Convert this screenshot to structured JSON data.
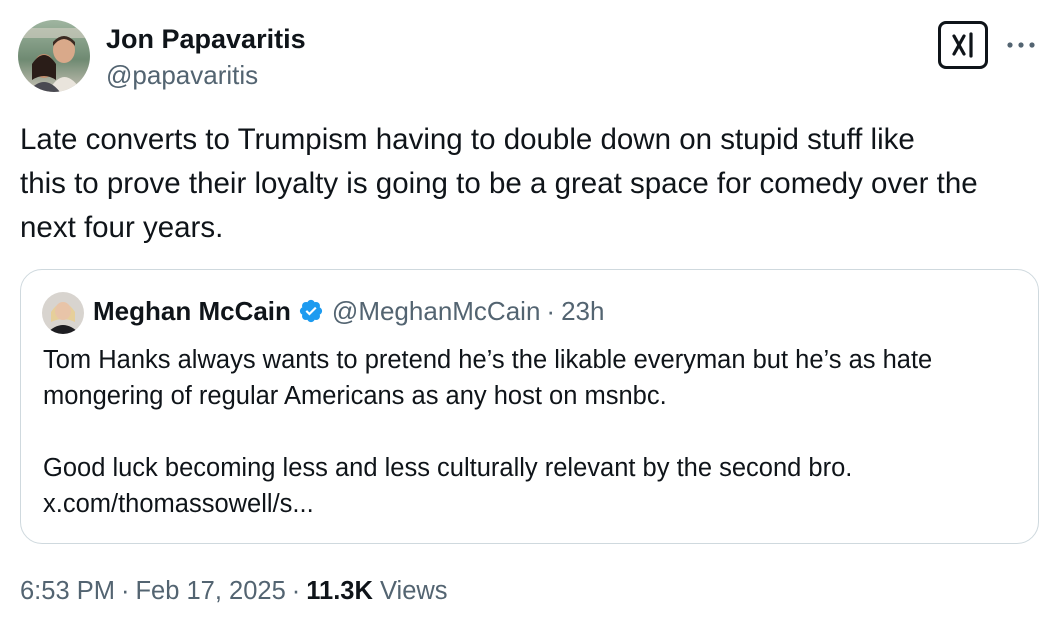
{
  "author": {
    "name": "Jon Papavaritis",
    "handle": "@papavaritis"
  },
  "tweet": {
    "text_lines": [
      "Late converts to Trumpism having to double down on stupid stuff like",
      "this to prove their loyalty is going to be a great space for comedy over the",
      "next four years."
    ]
  },
  "quoted_tweet": {
    "name": "Meghan McCain",
    "handle": "@MeghanMcCain",
    "separator": "·",
    "time": "23h",
    "paragraph1_lines": [
      "Tom Hanks always wants to pretend he’s the likable everyman but he’s as hate",
      "mongering of regular Americans as any host on msnbc."
    ],
    "paragraph2_lines": [
      "Good luck becoming less and less culturally relevant by the second bro.",
      "x.com/thomassowell/s..."
    ]
  },
  "meta": {
    "time": "6:53 PM",
    "separator": "·",
    "date": "Feb 17, 2025",
    "views_count": "11.3K",
    "views_label": "Views"
  },
  "icons": {
    "grok": "grok-icon",
    "more": "more-icon",
    "verified": "verified-badge-icon"
  },
  "colors": {
    "text_primary": "#0f1419",
    "text_secondary": "#536471",
    "border": "#cfd9de",
    "verified_blue": "#1d9bf0"
  }
}
